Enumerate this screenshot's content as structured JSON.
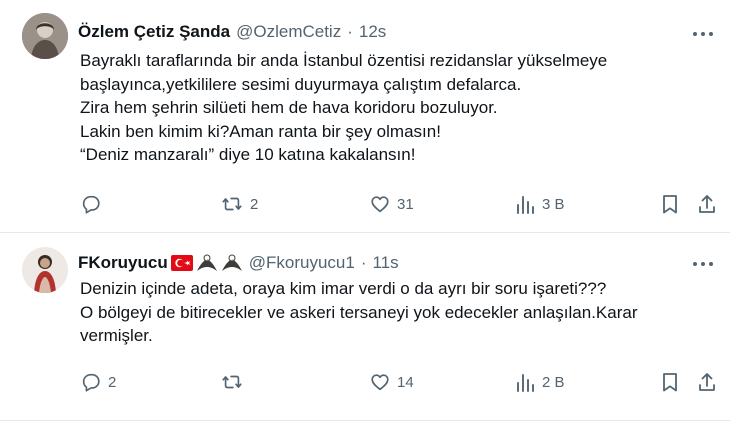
{
  "tweets": [
    {
      "author": "Özlem Çetiz Şanda",
      "handle": "@OzlemCetiz",
      "separator": "·",
      "time": "12s",
      "lines": [
        "Bayraklı taraflarında bir anda İstanbul özentisi rezidanslar yükselmeye",
        "başlayınca,yetkililere sesimi duyurmaya çalıştım defalarca.",
        "Zira hem şehrin silüeti hem de hava koridoru bozuluyor.",
        "Lakin ben kimim ki?Aman ranta bir şey olmasın!",
        "“Deniz manzaralı” diye 10 katına kakalansın!"
      ],
      "replies": "",
      "retweets": "2",
      "likes": "31",
      "views": "3 B"
    },
    {
      "author": "FKoruyucu",
      "handle": "@Fkoruyucu1",
      "separator": "·",
      "time": "11s",
      "lines": [
        "Denizin içinde adeta, oraya kim imar verdi o da ayrı bir soru işareti???",
        "O bölgeyi de bitirecekler ve askeri tersaneyi yok edecekler anlaşılan.Karar",
        "vermişler."
      ],
      "replies": "2",
      "retweets": "",
      "likes": "14",
      "views": "2 B"
    }
  ],
  "colors": {
    "text": "#0f1419",
    "secondary": "#536471",
    "border": "#e6e9eb",
    "flag": "#e30a17"
  },
  "icons": [
    "more-icon",
    "reply-icon",
    "retweet-icon",
    "like-icon",
    "views-icon",
    "bookmark-icon",
    "share-icon",
    "turkish-flag-icon",
    "eagle-icon"
  ]
}
